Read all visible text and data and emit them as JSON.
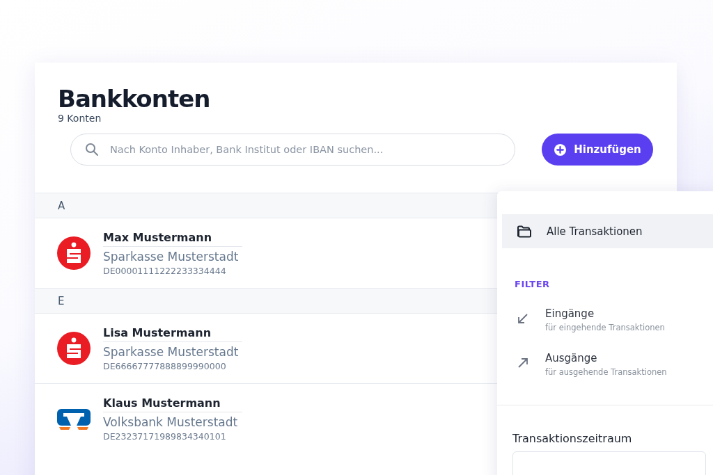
{
  "header": {
    "title": "Bankkonten",
    "subtitle": "9 Konten"
  },
  "search": {
    "placeholder": "Nach Konto Inhaber, Bank Institut oder IBAN suchen..."
  },
  "add_button": {
    "label": "Hinzufügen"
  },
  "groups": [
    {
      "letter": "A",
      "accounts": [
        {
          "name": "Max Mustermann",
          "bank": "Sparkasse Musterstadt",
          "iban": "DE00001111222233334444",
          "kind": "sparkasse"
        }
      ]
    },
    {
      "letter": "E",
      "accounts": [
        {
          "name": "Lisa Mustermann",
          "bank": "Sparkasse Musterstadt",
          "iban": "DE66667777888899990000",
          "kind": "sparkasse"
        },
        {
          "name": "Klaus Mustermann",
          "bank": "Volksbank Musterstadt",
          "iban": "DE23237171989834340101",
          "kind": "volksbank"
        }
      ]
    }
  ],
  "panel": {
    "all_item": {
      "label": "Alle Transaktionen",
      "selected": true
    },
    "filter_heading": "FILTER",
    "filters": [
      {
        "kind": "incoming",
        "label": "Eingänge",
        "description": "für eingehende Transaktionen",
        "selected": false
      },
      {
        "kind": "outgoing",
        "label": "Ausgänge",
        "description": "für ausgehende Transaktionen",
        "selected": false
      }
    ],
    "period_label": "Transaktionszeitraum"
  }
}
